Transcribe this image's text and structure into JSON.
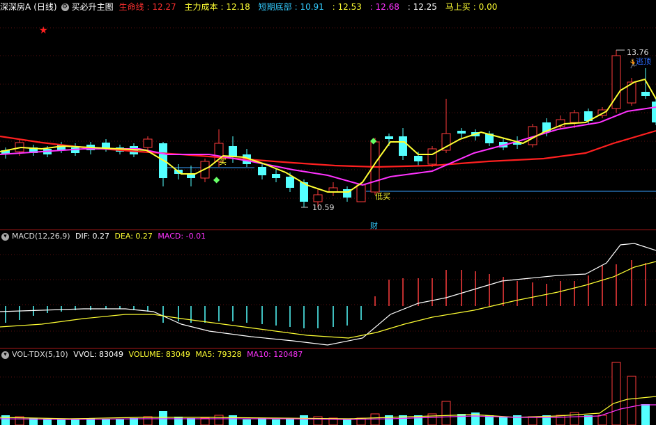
{
  "header": {
    "stock_name": "深深房A",
    "period": "(日线)",
    "indicator": "买必升主图",
    "items": [
      {
        "label": "生命线",
        "value": "12.27",
        "color": "#ff3030"
      },
      {
        "label": "主力成本",
        "value": "12.18",
        "color": "#ffff33"
      },
      {
        "label": "短期底部",
        "value": "10.91",
        "color": "#33ccff"
      },
      {
        "label": "",
        "value": "12.53",
        "color": "#ffff33"
      },
      {
        "label": "",
        "value": "12.68",
        "color": "#ff33ff"
      },
      {
        "label": "",
        "value": "12.25",
        "color": "#ffffff"
      },
      {
        "label": "马上买",
        "value": "0.00",
        "color": "#ffff33"
      }
    ]
  },
  "main_chart": {
    "high_marker": "13.76",
    "low_marker": "10.59",
    "buy_label": "买",
    "low_buy_label": "低买",
    "cai_label": "财",
    "top_right_label": "逃顶",
    "colors": {
      "up": "#ff3d3d",
      "down": "#54ffff",
      "ma_yellow": "#ffff33",
      "ma_magenta": "#ff33ff",
      "ma_red": "#ff2020",
      "support": "#3aa0ff"
    }
  },
  "macd": {
    "name": "MACD(12,26,9)",
    "dif_label": "DIF:",
    "dif_value": "0.27",
    "dea_label": "DEA:",
    "dea_value": "0.27",
    "macd_label": "MACD:",
    "macd_value": "-0.01"
  },
  "vol": {
    "name": "VOL-TDX(5,10)",
    "vvol_label": "VVOL:",
    "vvol_value": "83049",
    "volume_label": "VOLUME:",
    "volume_value": "83049",
    "ma5_label": "MA5:",
    "ma5_value": "79328",
    "ma10_label": "MA10:",
    "ma10_value": "120487"
  }
}
